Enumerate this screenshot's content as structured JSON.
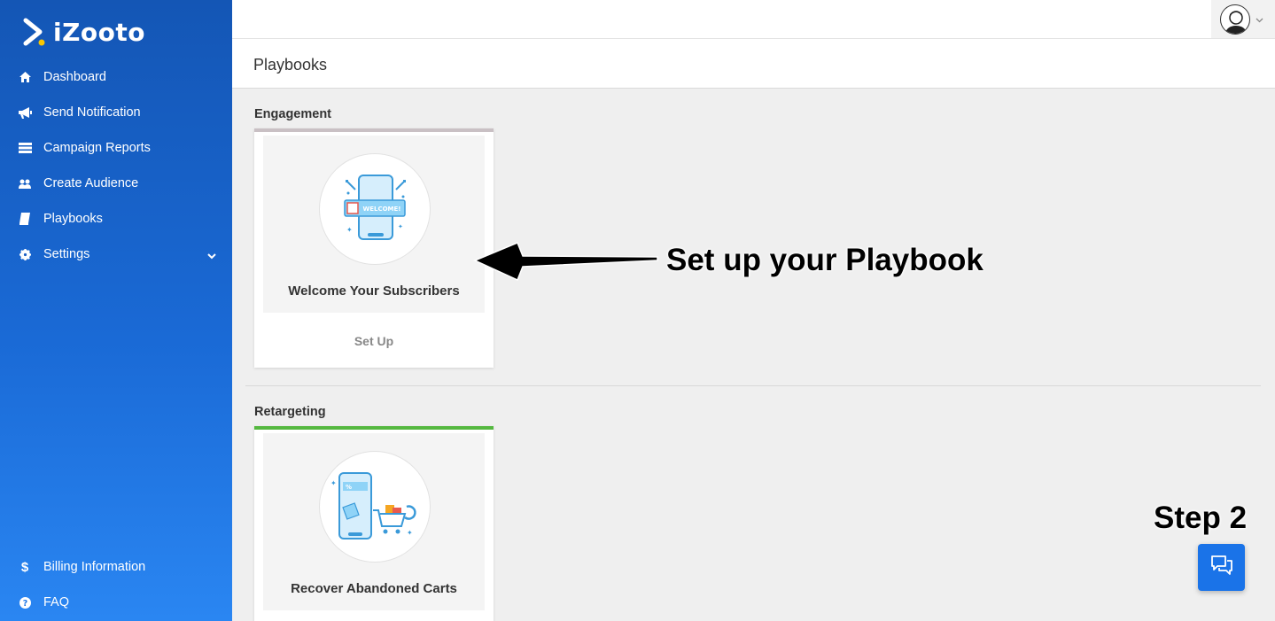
{
  "brand": {
    "name": "iZooto",
    "accent": "#f9c600"
  },
  "sidebar": {
    "items": [
      {
        "label": "Dashboard",
        "icon": "home-icon"
      },
      {
        "label": "Send Notification",
        "icon": "megaphone-icon"
      },
      {
        "label": "Campaign Reports",
        "icon": "reports-icon"
      },
      {
        "label": "Create Audience",
        "icon": "users-icon"
      },
      {
        "label": "Playbooks",
        "icon": "book-icon"
      },
      {
        "label": "Settings",
        "icon": "gear-icon"
      }
    ],
    "bottom": [
      {
        "label": "Billing Information",
        "icon": "dollar-icon"
      },
      {
        "label": "FAQ",
        "icon": "question-icon"
      }
    ]
  },
  "header": {
    "title": "Playbooks"
  },
  "sections": [
    {
      "title": "Engagement",
      "accent": "#c9c0c4",
      "card": {
        "name": "Welcome Your Subscribers",
        "action": "Set Up",
        "badge": "WELCOME!"
      }
    },
    {
      "title": "Retargeting",
      "accent": "#55b840",
      "card": {
        "name": "Recover Abandoned Carts",
        "badge": "%"
      }
    }
  ],
  "annotations": {
    "arrow_label": "Set up your Playbook",
    "step": "Step 2"
  }
}
